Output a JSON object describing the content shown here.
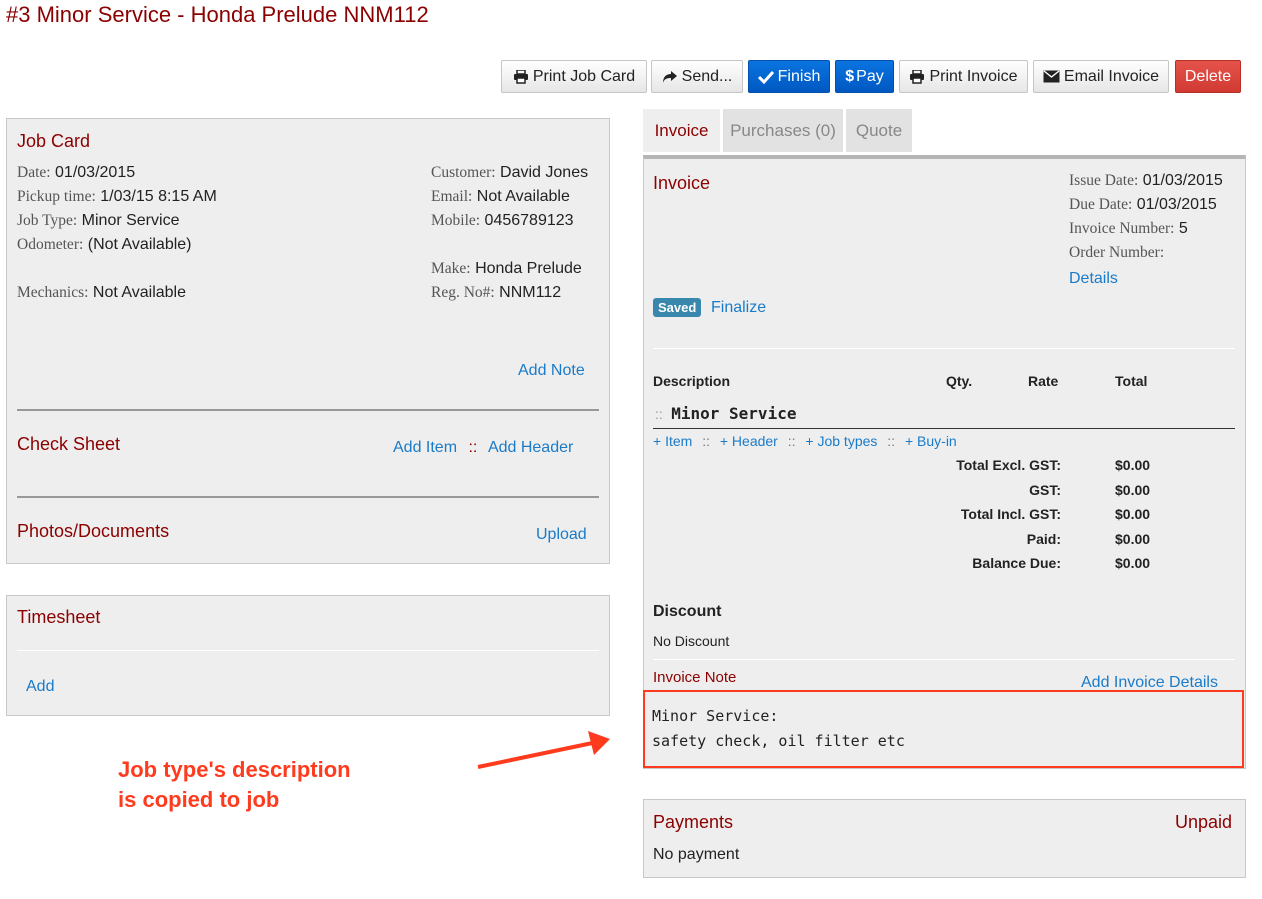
{
  "page": {
    "title": "#3 Minor Service - Honda Prelude NNM112"
  },
  "toolbar": {
    "print_job_card": "Print Job Card",
    "send": "Send...",
    "finish": "Finish",
    "pay": "Pay",
    "pay_symbol": "$",
    "print_invoice": "Print Invoice",
    "email_invoice": "Email Invoice",
    "delete": "Delete"
  },
  "job_card": {
    "title": "Job Card",
    "date_label": "Date:",
    "date": "01/03/2015",
    "pickup_label": "Pickup time:",
    "pickup": "1/03/15 8:15 AM",
    "job_type_label": "Job Type:",
    "job_type": "Minor Service",
    "odometer_label": "Odometer:",
    "odometer": "(Not Available)",
    "mechanics_label": "Mechanics:",
    "mechanics": "Not Available",
    "customer_label": "Customer:",
    "customer": "David Jones",
    "email_label": "Email:",
    "email": "Not Available",
    "mobile_label": "Mobile:",
    "mobile": "0456789123",
    "make_label": "Make:",
    "make": "Honda Prelude",
    "reg_label": "Reg. No#:",
    "reg": "NNM112",
    "add_note": "Add Note",
    "check_sheet_title": "Check Sheet",
    "add_item": "Add Item",
    "separator": "::",
    "add_header": "Add Header",
    "photos_title": "Photos/Documents",
    "upload": "Upload"
  },
  "timesheet": {
    "title": "Timesheet",
    "add": "Add"
  },
  "tabs": [
    {
      "label": "Invoice",
      "active": true
    },
    {
      "label": "Purchases (0)",
      "active": false
    },
    {
      "label": "Quote",
      "active": false
    }
  ],
  "invoice": {
    "title": "Invoice",
    "issue_date_label": "Issue Date:",
    "issue_date": "01/03/2015",
    "due_date_label": "Due Date:",
    "due_date": "01/03/2015",
    "invoice_number_label": "Invoice Number:",
    "invoice_number": "5",
    "order_number_label": "Order Number:",
    "details": "Details",
    "status_badge": "Saved",
    "finalize": "Finalize",
    "columns": {
      "description": "Description",
      "qty": "Qty.",
      "rate": "Rate",
      "total": "Total"
    },
    "section_prefix": "::",
    "section_name": "Minor Service",
    "add_links": [
      "+ Item",
      "+ Header",
      "+ Job types",
      "+ Buy-in"
    ],
    "add_sep": "::",
    "totals": [
      {
        "label": "Total Excl. GST:",
        "value": "$0.00"
      },
      {
        "label": "GST:",
        "value": "$0.00"
      },
      {
        "label": "Total Incl. GST:",
        "value": "$0.00"
      },
      {
        "label": "Paid:",
        "value": "$0.00"
      },
      {
        "label": "Balance Due:",
        "value": "$0.00"
      }
    ],
    "discount_title": "Discount",
    "discount_value": "No Discount",
    "note_title": "Invoice Note",
    "add_invoice_details": "Add Invoice Details",
    "note_line1": "Minor Service:",
    "note_line2": "safety check, oil filter etc"
  },
  "payments": {
    "title": "Payments",
    "status": "Unpaid",
    "value": "No payment"
  },
  "annotation": {
    "line1": "Job type's description",
    "line2": "is copied to job"
  },
  "colors": {
    "title": "#8b0000",
    "link": "#1a7bc9",
    "primary": "#0a6ad6",
    "danger": "#d9433b",
    "badge": "#3a87ad",
    "annotation": "#ff3b1e"
  }
}
